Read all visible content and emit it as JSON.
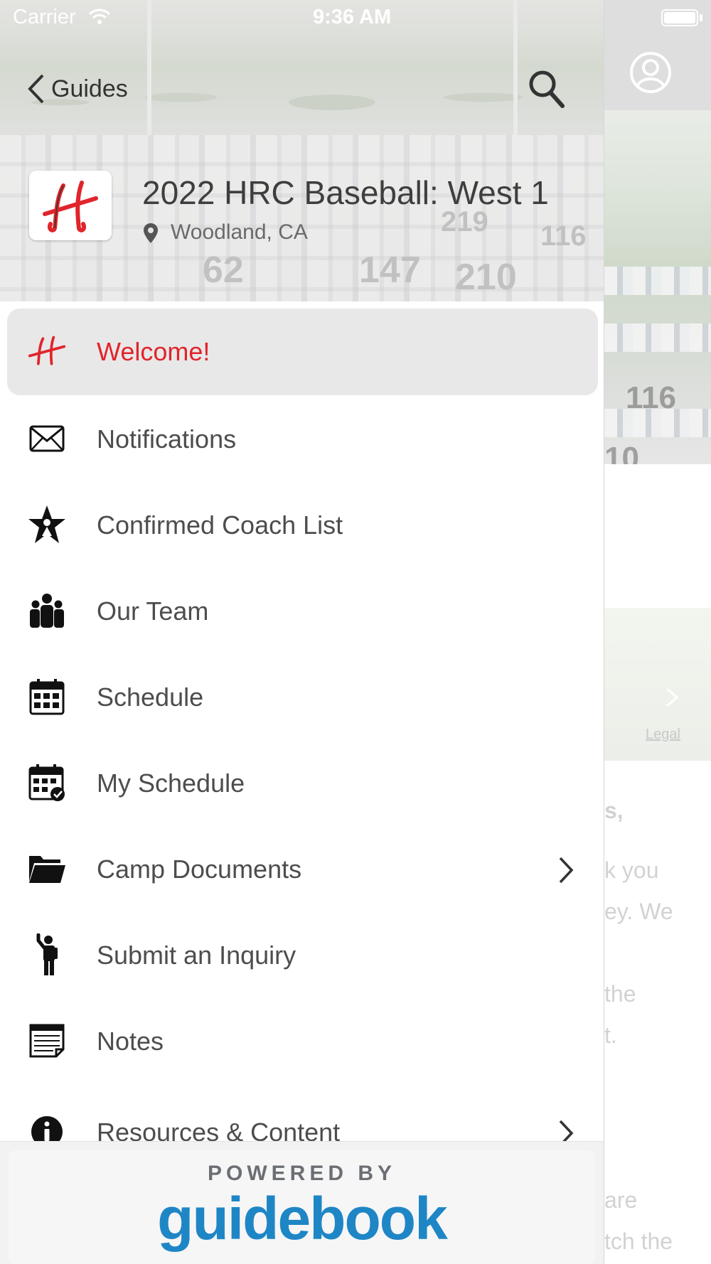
{
  "status_bar": {
    "carrier": "Carrier",
    "time": "9:36 AM"
  },
  "nav": {
    "back_label": "Guides"
  },
  "guide": {
    "title": "2022 HRC Baseball: West 1",
    "location": "Woodland, CA"
  },
  "menu": [
    {
      "label": "Welcome!",
      "icon": "hrc-logo-icon",
      "active": true,
      "chevron": false
    },
    {
      "label": "Notifications",
      "icon": "envelope-icon",
      "active": false,
      "chevron": false
    },
    {
      "label": "Confirmed Coach List",
      "icon": "star-person-icon",
      "active": false,
      "chevron": false
    },
    {
      "label": "Our Team",
      "icon": "people-icon",
      "active": false,
      "chevron": false
    },
    {
      "label": "Schedule",
      "icon": "calendar-icon",
      "active": false,
      "chevron": false
    },
    {
      "label": "My Schedule",
      "icon": "calendar-check-icon",
      "active": false,
      "chevron": false
    },
    {
      "label": "Camp Documents",
      "icon": "folder-icon",
      "active": false,
      "chevron": true
    },
    {
      "label": "Submit an Inquiry",
      "icon": "person-raising-hand-icon",
      "active": false,
      "chevron": false
    },
    {
      "label": "Notes",
      "icon": "notes-icon",
      "active": false,
      "chevron": false
    },
    {
      "label": "Resources & Content",
      "icon": "info-icon",
      "active": false,
      "chevron": true
    }
  ],
  "footer": {
    "powered_by": "POWERED BY",
    "brand": "guidebook"
  },
  "background_page": {
    "legal_link": "Legal",
    "text_fragments": [
      "s,",
      "k you",
      "ey. We",
      "the",
      "t.",
      "are",
      "tch the"
    ]
  },
  "colors": {
    "active_label": "#e0252b",
    "brand_blue": "#1f86c6",
    "active_row_bg": "#e8e8e8"
  }
}
